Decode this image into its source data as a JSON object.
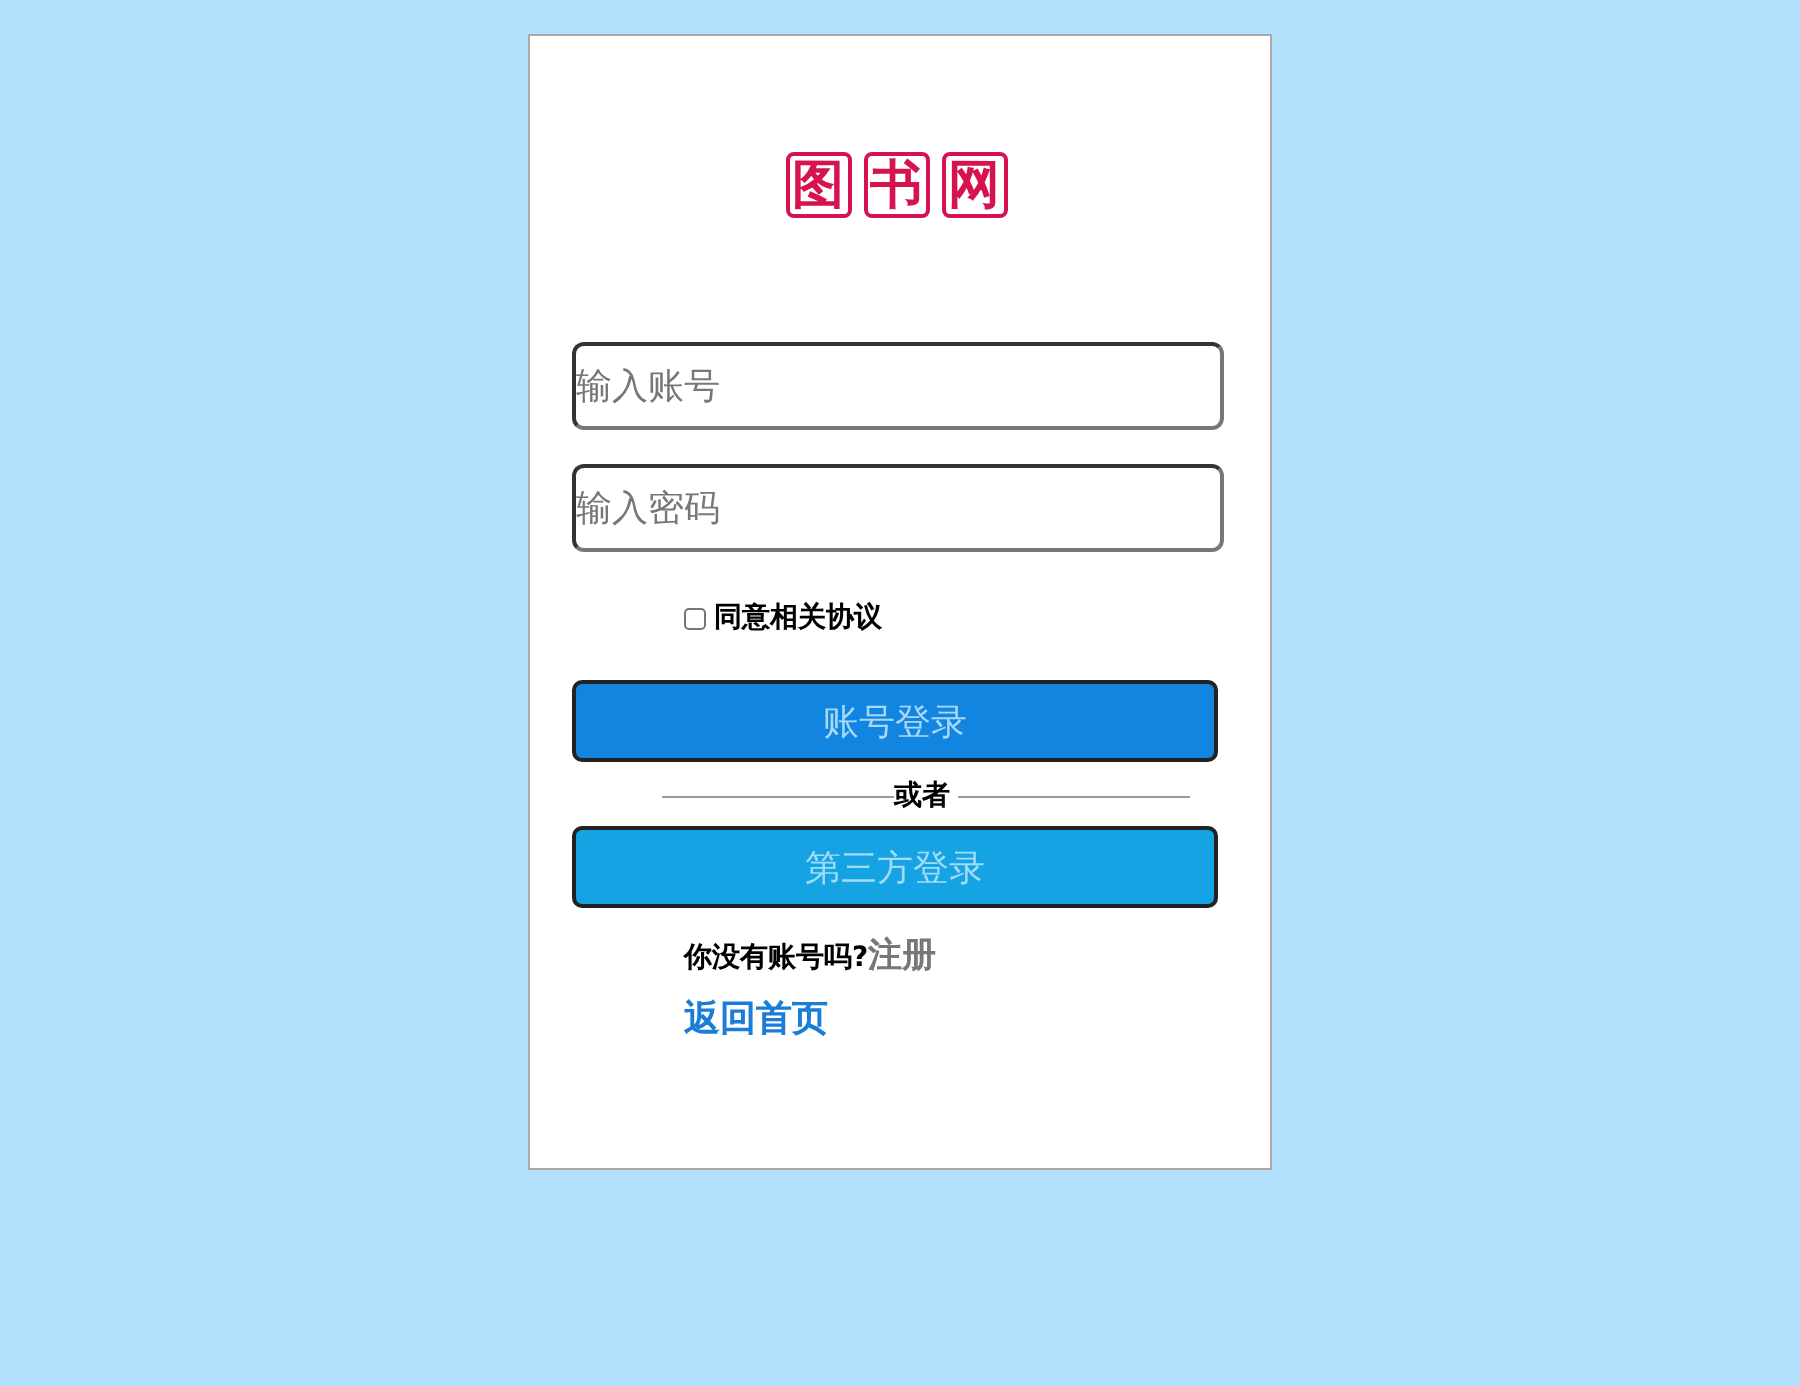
{
  "logo": {
    "characters": [
      "图",
      "书",
      "网"
    ]
  },
  "account_field": {
    "placeholder": "输入账号"
  },
  "password_field": {
    "placeholder": "输入密码"
  },
  "agreement": {
    "label": "同意相关协议",
    "checked": false
  },
  "login_button": "账号登录",
  "divider": "或者",
  "third_party_button": "第三方登录",
  "register": {
    "prompt": "你没有账号吗?",
    "link": "注册"
  },
  "home_link": "返回首页"
}
